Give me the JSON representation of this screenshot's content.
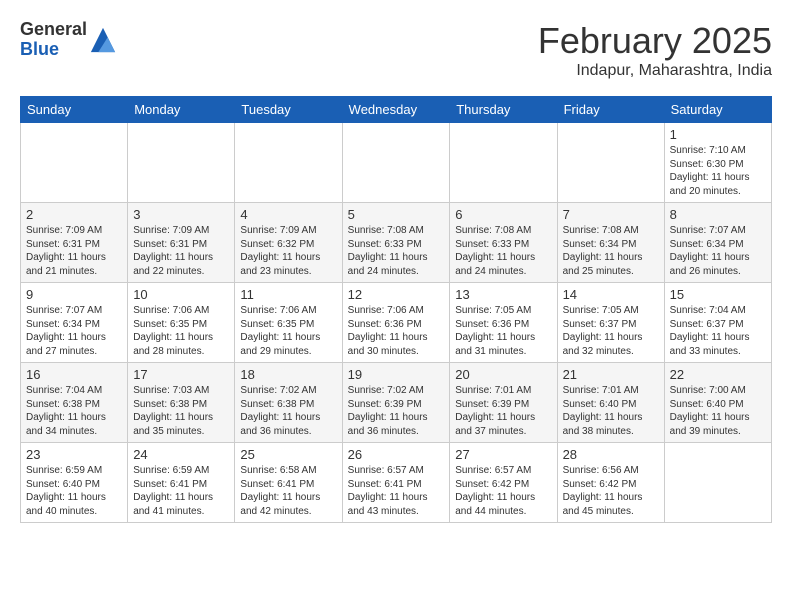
{
  "header": {
    "logo_general": "General",
    "logo_blue": "Blue",
    "month_title": "February 2025",
    "location": "Indapur, Maharashtra, India"
  },
  "days_of_week": [
    "Sunday",
    "Monday",
    "Tuesday",
    "Wednesday",
    "Thursday",
    "Friday",
    "Saturday"
  ],
  "weeks": [
    [
      {
        "day": "",
        "info": ""
      },
      {
        "day": "",
        "info": ""
      },
      {
        "day": "",
        "info": ""
      },
      {
        "day": "",
        "info": ""
      },
      {
        "day": "",
        "info": ""
      },
      {
        "day": "",
        "info": ""
      },
      {
        "day": "1",
        "info": "Sunrise: 7:10 AM\nSunset: 6:30 PM\nDaylight: 11 hours\nand 20 minutes."
      }
    ],
    [
      {
        "day": "2",
        "info": "Sunrise: 7:09 AM\nSunset: 6:31 PM\nDaylight: 11 hours\nand 21 minutes."
      },
      {
        "day": "3",
        "info": "Sunrise: 7:09 AM\nSunset: 6:31 PM\nDaylight: 11 hours\nand 22 minutes."
      },
      {
        "day": "4",
        "info": "Sunrise: 7:09 AM\nSunset: 6:32 PM\nDaylight: 11 hours\nand 23 minutes."
      },
      {
        "day": "5",
        "info": "Sunrise: 7:08 AM\nSunset: 6:33 PM\nDaylight: 11 hours\nand 24 minutes."
      },
      {
        "day": "6",
        "info": "Sunrise: 7:08 AM\nSunset: 6:33 PM\nDaylight: 11 hours\nand 24 minutes."
      },
      {
        "day": "7",
        "info": "Sunrise: 7:08 AM\nSunset: 6:34 PM\nDaylight: 11 hours\nand 25 minutes."
      },
      {
        "day": "8",
        "info": "Sunrise: 7:07 AM\nSunset: 6:34 PM\nDaylight: 11 hours\nand 26 minutes."
      }
    ],
    [
      {
        "day": "9",
        "info": "Sunrise: 7:07 AM\nSunset: 6:34 PM\nDaylight: 11 hours\nand 27 minutes."
      },
      {
        "day": "10",
        "info": "Sunrise: 7:06 AM\nSunset: 6:35 PM\nDaylight: 11 hours\nand 28 minutes."
      },
      {
        "day": "11",
        "info": "Sunrise: 7:06 AM\nSunset: 6:35 PM\nDaylight: 11 hours\nand 29 minutes."
      },
      {
        "day": "12",
        "info": "Sunrise: 7:06 AM\nSunset: 6:36 PM\nDaylight: 11 hours\nand 30 minutes."
      },
      {
        "day": "13",
        "info": "Sunrise: 7:05 AM\nSunset: 6:36 PM\nDaylight: 11 hours\nand 31 minutes."
      },
      {
        "day": "14",
        "info": "Sunrise: 7:05 AM\nSunset: 6:37 PM\nDaylight: 11 hours\nand 32 minutes."
      },
      {
        "day": "15",
        "info": "Sunrise: 7:04 AM\nSunset: 6:37 PM\nDaylight: 11 hours\nand 33 minutes."
      }
    ],
    [
      {
        "day": "16",
        "info": "Sunrise: 7:04 AM\nSunset: 6:38 PM\nDaylight: 11 hours\nand 34 minutes."
      },
      {
        "day": "17",
        "info": "Sunrise: 7:03 AM\nSunset: 6:38 PM\nDaylight: 11 hours\nand 35 minutes."
      },
      {
        "day": "18",
        "info": "Sunrise: 7:02 AM\nSunset: 6:38 PM\nDaylight: 11 hours\nand 36 minutes."
      },
      {
        "day": "19",
        "info": "Sunrise: 7:02 AM\nSunset: 6:39 PM\nDaylight: 11 hours\nand 36 minutes."
      },
      {
        "day": "20",
        "info": "Sunrise: 7:01 AM\nSunset: 6:39 PM\nDaylight: 11 hours\nand 37 minutes."
      },
      {
        "day": "21",
        "info": "Sunrise: 7:01 AM\nSunset: 6:40 PM\nDaylight: 11 hours\nand 38 minutes."
      },
      {
        "day": "22",
        "info": "Sunrise: 7:00 AM\nSunset: 6:40 PM\nDaylight: 11 hours\nand 39 minutes."
      }
    ],
    [
      {
        "day": "23",
        "info": "Sunrise: 6:59 AM\nSunset: 6:40 PM\nDaylight: 11 hours\nand 40 minutes."
      },
      {
        "day": "24",
        "info": "Sunrise: 6:59 AM\nSunset: 6:41 PM\nDaylight: 11 hours\nand 41 minutes."
      },
      {
        "day": "25",
        "info": "Sunrise: 6:58 AM\nSunset: 6:41 PM\nDaylight: 11 hours\nand 42 minutes."
      },
      {
        "day": "26",
        "info": "Sunrise: 6:57 AM\nSunset: 6:41 PM\nDaylight: 11 hours\nand 43 minutes."
      },
      {
        "day": "27",
        "info": "Sunrise: 6:57 AM\nSunset: 6:42 PM\nDaylight: 11 hours\nand 44 minutes."
      },
      {
        "day": "28",
        "info": "Sunrise: 6:56 AM\nSunset: 6:42 PM\nDaylight: 11 hours\nand 45 minutes."
      },
      {
        "day": "",
        "info": ""
      }
    ]
  ]
}
